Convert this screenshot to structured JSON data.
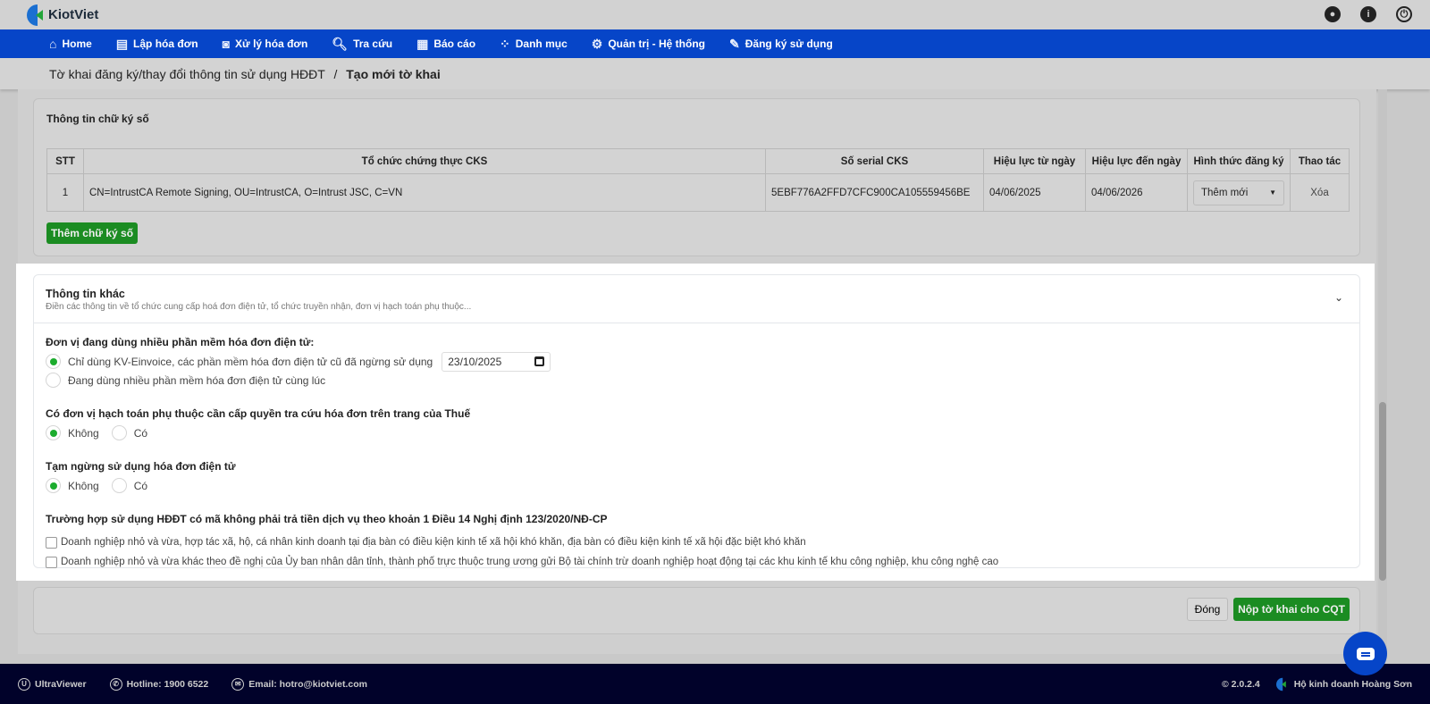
{
  "app": {
    "name": "KiotViet"
  },
  "nav": [
    {
      "icon": "home-icon",
      "label": "Home",
      "glyph": "⌂"
    },
    {
      "icon": "invoice-add-icon",
      "label": "Lập hóa đơn",
      "glyph": "▤"
    },
    {
      "icon": "invoice-process-icon",
      "label": "Xử lý hóa đơn",
      "glyph": "◙"
    },
    {
      "icon": "search-icon",
      "label": "Tra cứu",
      "glyph": "🔍︎"
    },
    {
      "icon": "report-icon",
      "label": "Báo cáo",
      "glyph": "▦"
    },
    {
      "icon": "category-icon",
      "label": "Danh mục",
      "glyph": "⁘"
    },
    {
      "icon": "admin-icon",
      "label": "Quản trị - Hệ thống",
      "glyph": "⚙"
    },
    {
      "icon": "register-icon",
      "label": "Đăng ký sử dụng",
      "glyph": "✎"
    }
  ],
  "breadcrumb": {
    "parent": "Tờ khai đăng ký/thay đổi thông tin sử dụng HĐĐT",
    "separator": "/",
    "current": "Tạo mới tờ khai"
  },
  "signature": {
    "title": "Thông tin chữ ký số",
    "columns": [
      "STT",
      "Tổ chức chứng thực CKS",
      "Số serial CKS",
      "Hiệu lực từ ngày",
      "Hiệu lực đến ngày",
      "Hình thức đăng ký",
      "Thao tác"
    ],
    "rows": [
      {
        "stt": "1",
        "org": "CN=IntrustCA Remote Signing, OU=IntrustCA, O=Intrust JSC, C=VN",
        "serial": "5EBF776A2FFD7CFC900CA105559456BE",
        "from": "04/06/2025",
        "to": "04/06/2026",
        "type": "Thêm mới",
        "action": "Xóa"
      }
    ],
    "add_button": "Thêm chữ ký số"
  },
  "other": {
    "title": "Thông tin khác",
    "subtitle": "Điền các thông tin về tổ chức cung cấp hoá đơn điện tử, tổ chức truyền nhận, đơn vị hạch toán phụ thuộc...",
    "q1": {
      "label": "Đơn vị đang dùng nhiều phần mềm hóa đơn điện tử:",
      "opt1": "Chỉ dùng KV-Einvoice, các phần mềm hóa đơn điện tử cũ đã ngừng sử dụng",
      "date": "23/10/2025",
      "opt2": "Đang dùng nhiều phần mềm hóa đơn điện tử cùng lúc"
    },
    "q2": {
      "label": "Có đơn vị hạch toán phụ thuộc cần cấp quyền tra cứu hóa đơn trên trang của Thuế",
      "no": "Không",
      "yes": "Có"
    },
    "q3": {
      "label": "Tạm ngừng sử dụng hóa đơn điện tử",
      "no": "Không",
      "yes": "Có"
    },
    "q4": {
      "label": "Trường hợp sử dụng HĐĐT có mã không phải trả tiền dịch vụ theo khoản 1 Điều 14 Nghị định 123/2020/NĐ-CP",
      "c1": "Doanh nghiệp nhỏ và vừa, hợp tác xã, hộ, cá nhân kinh doanh tại địa bàn có điều kiện kinh tế xã hội khó khăn, địa bàn có điều kiện kinh tế xã hội đặc biệt khó khăn",
      "c2": "Doanh nghiệp nhỏ và vừa khác theo đề nghị của Ủy ban nhân dân tỉnh, thành phố trực thuộc trung ương gửi Bộ tài chính trừ doanh nghiệp hoạt động tại các khu kinh tế khu công nghiệp, khu công nghệ cao"
    }
  },
  "actions": {
    "close": "Đóng",
    "submit": "Nộp tờ khai cho CQT"
  },
  "footer": {
    "ultraviewer": "UltraViewer",
    "hotline": "Hotline: 1900 6522",
    "email": "Email: hotro@kiotviet.com",
    "version": "© 2.0.2.4",
    "business": "Hộ kinh doanh Hoàng Sơn"
  }
}
